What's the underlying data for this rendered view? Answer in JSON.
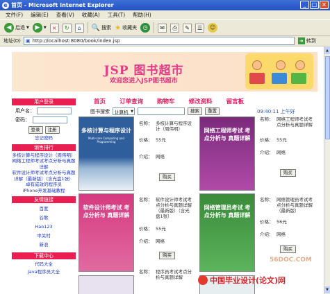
{
  "window": {
    "title": "首页 - Microsoft Internet Explorer",
    "icon": "ie-icon"
  },
  "menu": [
    "文件(F)",
    "编辑(E)",
    "查看(V)",
    "收藏(A)",
    "工具(T)",
    "帮助(H)"
  ],
  "toolbar": {
    "back": "后退",
    "search": "搜索",
    "favorites": "收藏夹"
  },
  "address": {
    "label": "地址(D)",
    "url": "http://localhost:8080/book/index.jsp",
    "go": "转到"
  },
  "banner": {
    "title": "JSP 图书超市",
    "subtitle": "欢迎您进入JSP图书超市"
  },
  "nav": [
    "首页",
    "订单查询",
    "购物车",
    "修改资料",
    "留言板"
  ],
  "login": {
    "header": "用户登录",
    "username_label": "用户名：",
    "password_label": "密码：",
    "login_btn": "登录",
    "register_btn": "注册",
    "forgot_link": "忘记密码"
  },
  "bestsellers": {
    "header": "销售排行",
    "items": [
      "多核计算与程序设计（周伟明）",
      "网络工程师考试考点分析与真题详解",
      "软件设计师考试考点分析与真题详解（最新版）（含光盘1张）",
      "卓有成效的程序员",
      "iPhone开发基础教程"
    ]
  },
  "links": {
    "header": "友情链接",
    "items": [
      "百度",
      "谷歌",
      "Hao123",
      "中关村",
      "新浪"
    ]
  },
  "download": {
    "header": "下载中心",
    "items": [
      "代码大全",
      "Java程序员大全"
    ]
  },
  "search": {
    "label": "图书搜索",
    "select": "计算机",
    "search_btn": "搜索",
    "reset_btn": "重置"
  },
  "date": "09:40:11 上午好",
  "labels": {
    "name": "名称：",
    "price": "价格：",
    "intro": "介绍：",
    "buy": "购买"
  },
  "books": [
    {
      "cover_title": "多核计算与程序设计",
      "cover_sub": "Multi-core Computing and Programming",
      "name": "多核计算与程序设计（周伟明）",
      "price": "55元",
      "intro": "网络"
    },
    {
      "cover_title": "网络工程师考试 考点分析与 真题详解",
      "name": "网络工程师考试考点分析与真题详解",
      "price": "55元",
      "intro": "网络"
    },
    {
      "cover_title": "软件设计师考试 考点分析与 真题详解",
      "name": "软件设计师考试考点分析与真题详解（最新版）（含光盘1张）",
      "price": "55元",
      "intro": "网络"
    },
    {
      "cover_title": "网络管理员考试 考点分析与 真题详解",
      "name": "网络管理员考试考点分析与真题详解（最新版）",
      "price": "56元",
      "intro": "网络"
    },
    {
      "name": "程序员考试考点分析与真题详解"
    }
  ],
  "footer": {
    "brand": "中国毕业设计(论文)网",
    "watermark": "56DOC.COM"
  },
  "colors": {
    "accent": "#ea1f51",
    "nav": "#e21c62",
    "link": "#1a36c2",
    "title_pink": "#e23b8a"
  }
}
